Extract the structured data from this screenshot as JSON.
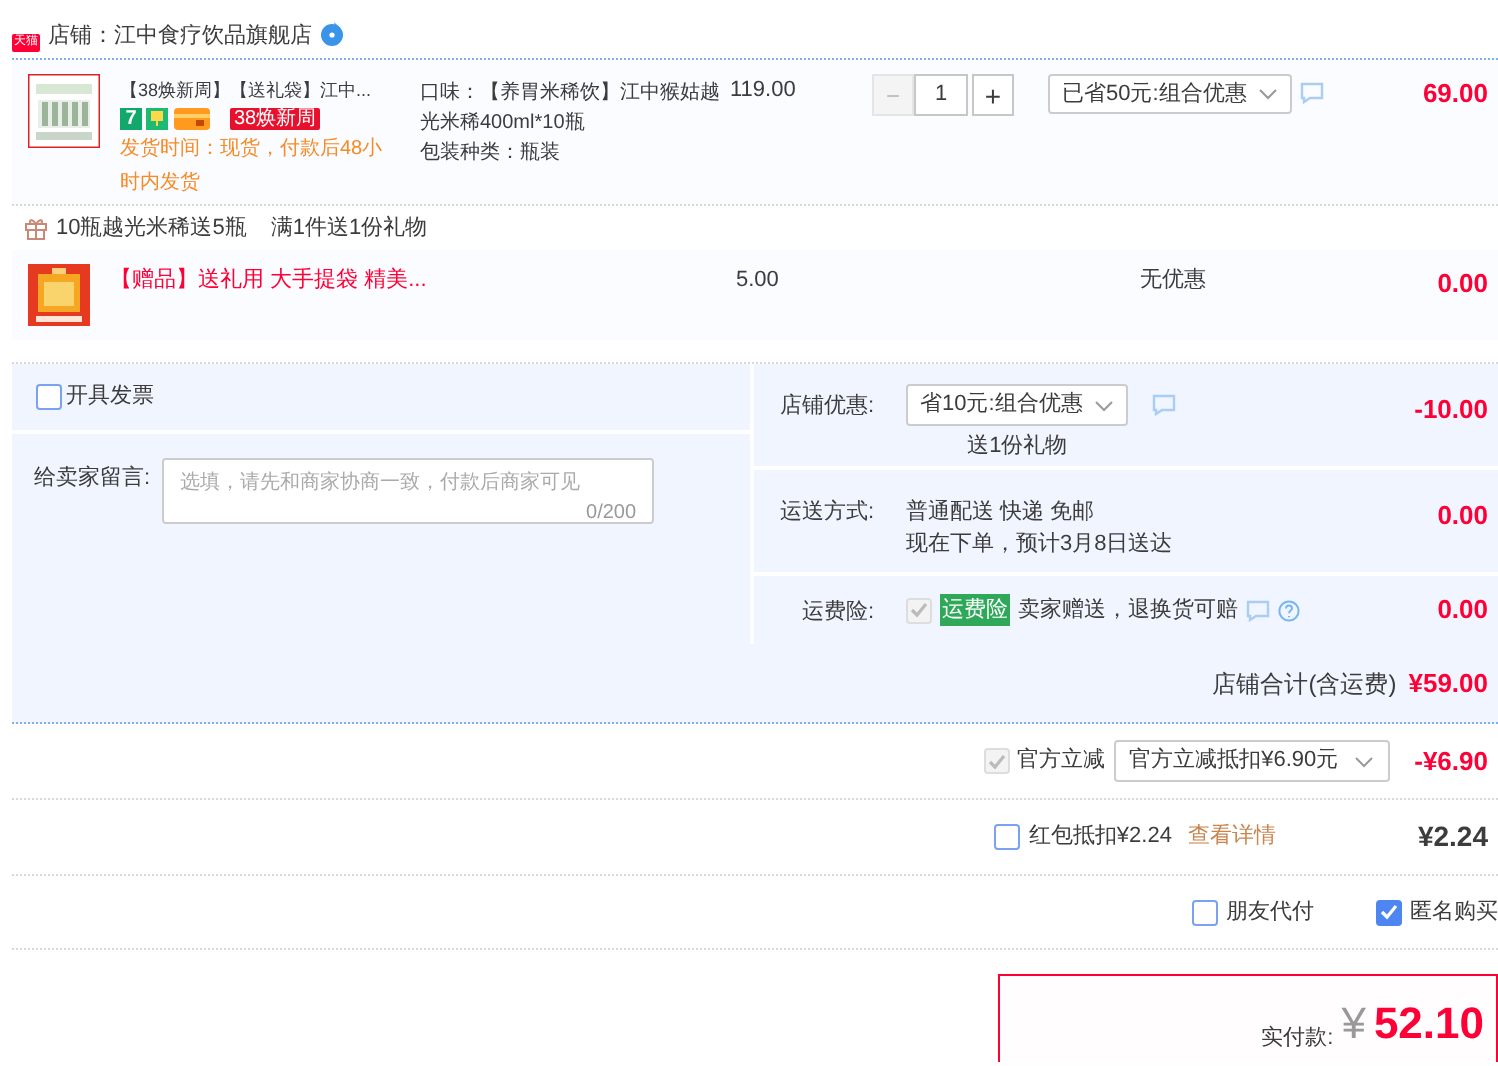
{
  "shop": {
    "badge": "天猫",
    "name": "店铺：江中食疗饮品旗舰店"
  },
  "product": {
    "title": "【38焕新周】【送礼袋】江中...",
    "tags": [
      {
        "kind": "number",
        "text": "7"
      },
      {
        "kind": "symbol"
      },
      {
        "kind": "card"
      },
      {
        "kind": "label",
        "text": "38焕新周"
      }
    ],
    "shipping_note": "发货时间：现货，付款后48小时内发货",
    "specs": [
      "口味：【养胃米稀饮】江中猴姑越光米稀400ml*10瓶",
      "包装种类：瓶装"
    ],
    "price": "119.00",
    "quantity": {
      "decrement": "−",
      "value": "1",
      "increment": "+",
      "decrement_disabled": true
    },
    "discount": "已省50元:组合优惠",
    "total": "69.00"
  },
  "gift_promos": [
    "10瓶越光米稀送5瓶",
    "满1件送1份礼物"
  ],
  "gift": {
    "title": "【赠品】送礼用 大手提袋 精美...",
    "price": "5.00",
    "discount": "无优惠",
    "total": "0.00"
  },
  "invoice": {
    "label": "开具发票",
    "checked": false
  },
  "message": {
    "label": "给卖家留言:",
    "placeholder": "选填，请先和商家协商一致，付款后商家可见",
    "counter": "0/200"
  },
  "store_discount": {
    "label": "店铺优惠:",
    "select": "省10元:组合优惠",
    "note": "送1份礼物",
    "amount": "-10.00"
  },
  "delivery": {
    "label": "运送方式:",
    "lines": [
      "普通配送 快递 免邮",
      "现在下单，预计3月8日送达"
    ],
    "amount": "0.00"
  },
  "insurance": {
    "label": "运费险:",
    "checked": true,
    "disabled": true,
    "tag": "运费险",
    "text": "卖家赠送，退换货可赔",
    "amount": "0.00"
  },
  "store_total": {
    "label": "店铺合计(含运费)",
    "amount": "¥59.00"
  },
  "official_discount": {
    "label": "官方立减",
    "checked": true,
    "disabled": true,
    "select": "官方立减抵扣¥6.90元",
    "amount": "-¥6.90"
  },
  "red_packet": {
    "label": "红包抵扣¥2.24",
    "checked": false,
    "link": "查看详情",
    "amount": "¥2.24"
  },
  "options": [
    {
      "label": "朋友代付",
      "checked": false
    },
    {
      "label": "匿名购买",
      "checked": true
    }
  ],
  "payment": {
    "label": "实付款:",
    "currency": "¥",
    "amount": "52.10"
  }
}
